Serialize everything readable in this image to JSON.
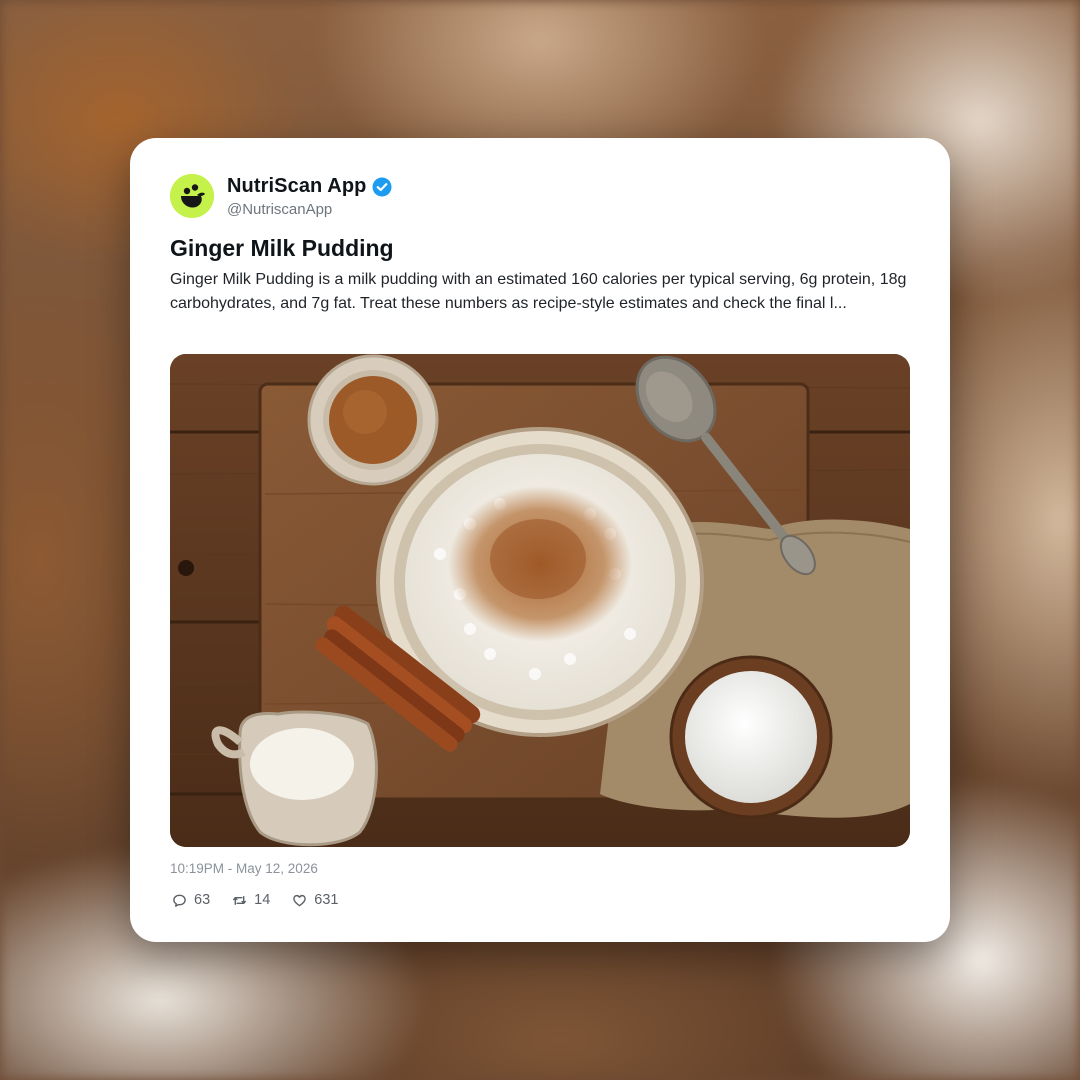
{
  "account": {
    "name": "NutriScan App",
    "handle": "@NutriscanApp",
    "verified": true,
    "avatar_color": "#c5f24a",
    "verified_color": "#1d9bf0"
  },
  "post": {
    "title": "Ginger Milk Pudding",
    "text": "Ginger Milk Pudding is a milk pudding with an estimated 160 calories per typical serving, 6g protein, 18g carbohydrates, and 7g fat. Treat these numbers as recipe-style estimates and check the final l...",
    "timestamp": "10:19PM - May 12, 2026"
  },
  "stats": {
    "replies": "63",
    "reposts": "14",
    "likes": "631"
  },
  "icons": {
    "reply": "reply-icon",
    "repost": "repost-icon",
    "like": "heart-icon",
    "verified": "verified-badge-icon"
  }
}
